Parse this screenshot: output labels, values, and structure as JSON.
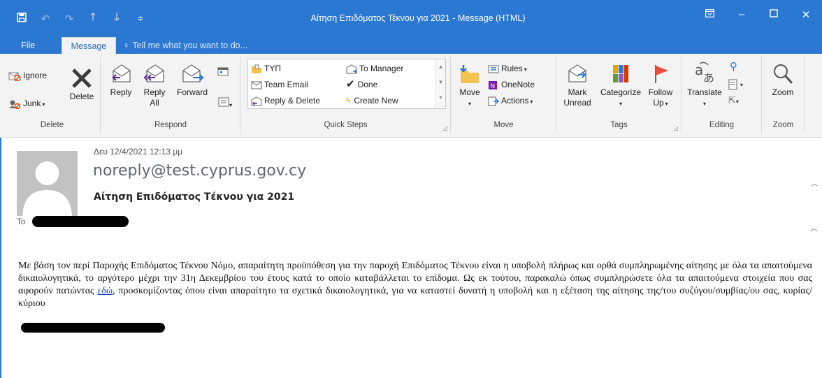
{
  "window": {
    "title": "Αίτηση Επιδόματος Τέκνου για 2021 - Message (HTML)",
    "qat": [
      "save",
      "undo",
      "redo",
      "up",
      "down",
      "customize"
    ],
    "controls": [
      "ribbon-display",
      "minimize",
      "maximize",
      "close"
    ]
  },
  "tabs": {
    "file": "File",
    "message": "Message",
    "tellme": "Tell me what you want to do..."
  },
  "ribbon": {
    "delete_group": {
      "ignore": "Ignore",
      "junk": "Junk",
      "delete": "Delete",
      "label": "Delete"
    },
    "respond_group": {
      "reply": "Reply",
      "reply_all_1": "Reply",
      "reply_all_2": "All",
      "forward": "Forward",
      "label": "Respond"
    },
    "quicksteps_group": {
      "items": [
        "ΤΥΠ",
        "To Manager",
        "Team Email",
        "Done",
        "Reply & Delete",
        "Create New"
      ],
      "label": "Quick Steps"
    },
    "move_group": {
      "move": "Move",
      "rules": "Rules",
      "onenote": "OneNote",
      "actions": "Actions",
      "label": "Move"
    },
    "tags_group": {
      "mark_1": "Mark",
      "mark_2": "Unread",
      "categorize": "Categorize",
      "follow_1": "Follow",
      "follow_2": "Up",
      "label": "Tags"
    },
    "editing_group": {
      "translate": "Translate",
      "label": "Editing"
    },
    "zoom_group": {
      "zoom": "Zoom",
      "label": "Zoom"
    }
  },
  "message": {
    "date": "Δευ 12/4/2021 12:13 μμ",
    "sender": "noreply@test.cyprus.gov.cy",
    "subject": "Αίτηση Επιδόματος Τέκνου για 2021",
    "to_label": "To",
    "body_part1": "Με βάση τον περί Παροχής Επιδόματος Τέκνου Νόμο, απαραίτητη προϋπόθεση για την παροχή Επιδόματος Τέκνου είναι η υποβολή πλήρως και ορθά συμπληρωμένης αίτησης με όλα τα απαιτούμενα δικαιολογητικά, το αργότερο μέχρι την 31η Δεκεμβρίου του έτους κατά το οποίο καταβάλλεται το επίδομα. Ως εκ τούτου, παρακαλώ όπως συμπληρώσετε όλα τα απαιτούμενα στοιχεία που σας αφορούν πατώντας ",
    "link_text": "εδώ",
    "body_part2": ", προσκομίζοντας όπου είναι απαραίτητο τα σχετικά δικαιολογητικά, για να καταστεί δυνατή η υποβολή και η εξέταση της αίτησης της/του συζύγου/συμβίας/ου σας, κυρίας/κύριου"
  },
  "colors": {
    "accent": "#2b78d3",
    "ribbon_bg": "#f3f3f3",
    "link": "#1a46c8"
  }
}
